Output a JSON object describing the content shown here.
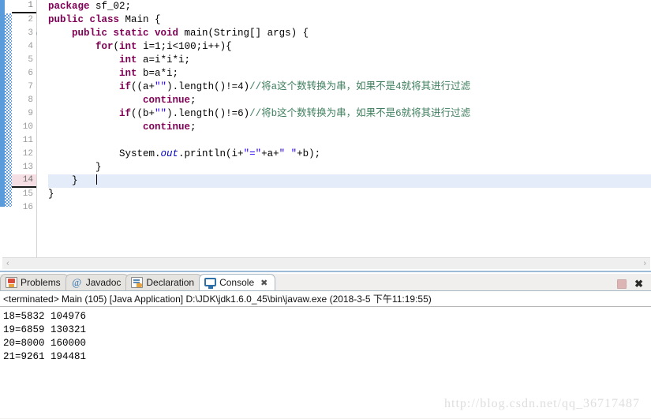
{
  "editor": {
    "lines": [
      {
        "n": "1",
        "segments": [
          {
            "t": "package ",
            "c": "kw"
          },
          {
            "t": "sf_02;",
            "c": ""
          }
        ]
      },
      {
        "n": "2",
        "segments": [
          {
            "t": "public class ",
            "c": "kw"
          },
          {
            "t": "Main {",
            "c": ""
          }
        ]
      },
      {
        "n": "3",
        "fold": true,
        "segments": [
          {
            "t": "    ",
            "c": ""
          },
          {
            "t": "public static void ",
            "c": "kw"
          },
          {
            "t": "main(String[] args) {",
            "c": ""
          }
        ]
      },
      {
        "n": "4",
        "segments": [
          {
            "t": "        ",
            "c": ""
          },
          {
            "t": "for",
            "c": "kw"
          },
          {
            "t": "(",
            "c": ""
          },
          {
            "t": "int",
            "c": "kw"
          },
          {
            "t": " i=1;i<100;i++){",
            "c": ""
          }
        ]
      },
      {
        "n": "5",
        "segments": [
          {
            "t": "            ",
            "c": ""
          },
          {
            "t": "int",
            "c": "kw"
          },
          {
            "t": " a=i*i*i;",
            "c": ""
          }
        ]
      },
      {
        "n": "6",
        "segments": [
          {
            "t": "            ",
            "c": ""
          },
          {
            "t": "int",
            "c": "kw"
          },
          {
            "t": " b=a*i;",
            "c": ""
          }
        ]
      },
      {
        "n": "7",
        "segments": [
          {
            "t": "            ",
            "c": ""
          },
          {
            "t": "if",
            "c": "kw"
          },
          {
            "t": "((a+",
            "c": ""
          },
          {
            "t": "\"\"",
            "c": "str"
          },
          {
            "t": ").length()!=4)",
            "c": ""
          },
          {
            "t": "//将a这个数转换为串，如果不是4就将其进行过滤",
            "c": "cmt"
          }
        ]
      },
      {
        "n": "8",
        "segments": [
          {
            "t": "                ",
            "c": ""
          },
          {
            "t": "continue",
            "c": "kw"
          },
          {
            "t": ";",
            "c": ""
          }
        ]
      },
      {
        "n": "9",
        "segments": [
          {
            "t": "            ",
            "c": ""
          },
          {
            "t": "if",
            "c": "kw"
          },
          {
            "t": "((b+",
            "c": ""
          },
          {
            "t": "\"\"",
            "c": "str"
          },
          {
            "t": ").length()!=6)",
            "c": ""
          },
          {
            "t": "//将b这个数转换为串，如果不是6就将其进行过滤",
            "c": "cmt"
          }
        ]
      },
      {
        "n": "10",
        "segments": [
          {
            "t": "                ",
            "c": ""
          },
          {
            "t": "continue",
            "c": "kw"
          },
          {
            "t": ";",
            "c": ""
          }
        ]
      },
      {
        "n": "11",
        "segments": [
          {
            "t": "",
            "c": ""
          }
        ]
      },
      {
        "n": "12",
        "segments": [
          {
            "t": "            System.",
            "c": ""
          },
          {
            "t": "out",
            "c": "fld"
          },
          {
            "t": ".println(i+",
            "c": ""
          },
          {
            "t": "\"=\"",
            "c": "str"
          },
          {
            "t": "+a+",
            "c": ""
          },
          {
            "t": "\" \"",
            "c": "str"
          },
          {
            "t": "+b);",
            "c": ""
          }
        ]
      },
      {
        "n": "13",
        "segments": [
          {
            "t": "        }",
            "c": ""
          }
        ]
      },
      {
        "n": "14",
        "current": true,
        "caret": true,
        "segments": [
          {
            "t": "    }",
            "c": ""
          }
        ]
      },
      {
        "n": "15",
        "segments": [
          {
            "t": "}",
            "c": ""
          }
        ]
      },
      {
        "n": "16",
        "segments": [
          {
            "t": "",
            "c": ""
          }
        ]
      }
    ],
    "scroll_left_label": "‹",
    "scroll_right_label": "›"
  },
  "console": {
    "tabs": [
      {
        "label": "Problems",
        "icon": "problems-icon",
        "active": false,
        "closable": false
      },
      {
        "label": "Javadoc",
        "icon": "javadoc-icon",
        "active": false,
        "closable": false
      },
      {
        "label": "Declaration",
        "icon": "declaration-icon",
        "active": false,
        "closable": false
      },
      {
        "label": "Console",
        "icon": "console-icon",
        "active": true,
        "closable": true
      }
    ],
    "close_glyph": "✖",
    "tools": {
      "terminate_label": "",
      "remove_all_label": "✖"
    },
    "status_line": "<terminated> Main (105) [Java Application] D:\\JDK\\jdk1.6.0_45\\bin\\javaw.exe (2018-3-5 下午11:19:55)",
    "output_lines": [
      "18=5832 104976",
      "19=6859 130321",
      "20=8000 160000",
      "21=9261 194481"
    ]
  },
  "watermark": {
    "text": "http://blog.csdn.net/qq_36717487"
  },
  "colors": {
    "keyword": "#7f0055",
    "string": "#2a00ff",
    "comment": "#3f7f5f",
    "field": "#0000c0",
    "current_line": "#e3ecf8",
    "current_line_number": "#f5dfe4",
    "change_bar": "#5a9bdc"
  }
}
